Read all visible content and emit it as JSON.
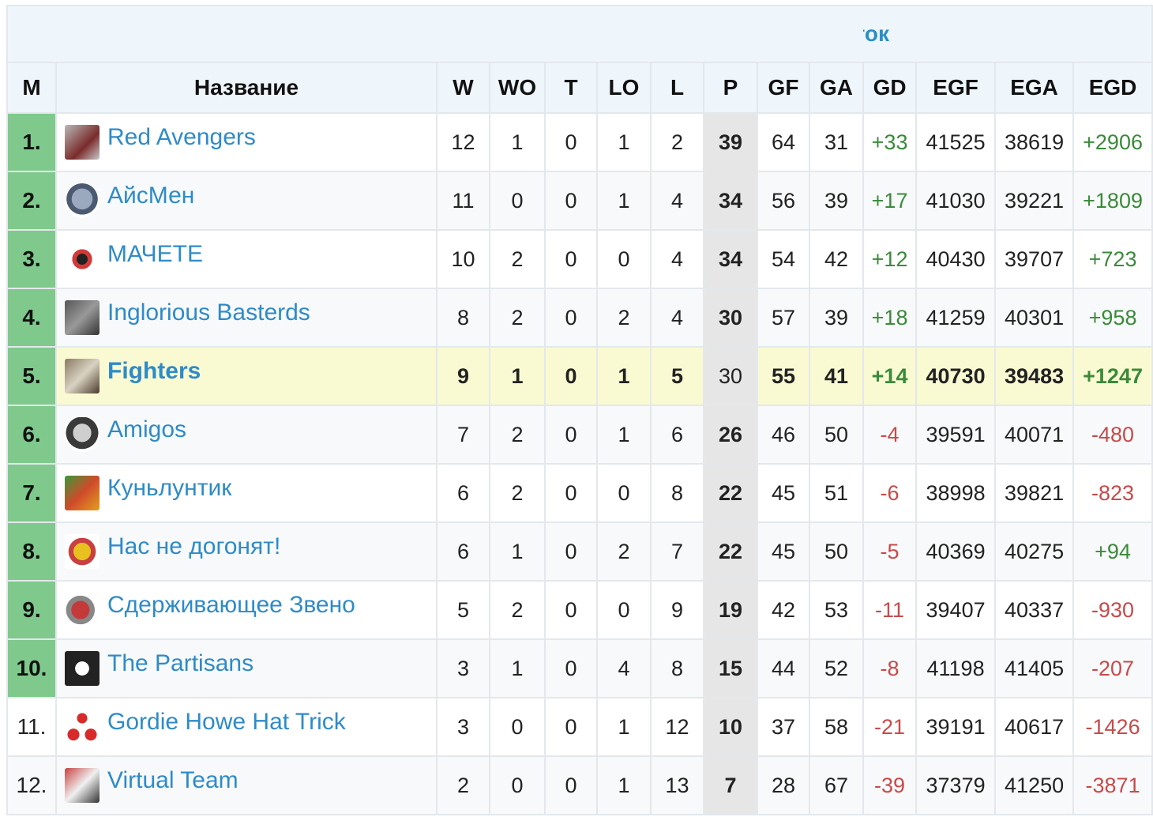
{
  "conference": "Восток",
  "columns": [
    "М",
    "Название",
    "W",
    "WO",
    "T",
    "LO",
    "L",
    "P",
    "GF",
    "GA",
    "GD",
    "EGF",
    "EGA",
    "EGD"
  ],
  "colors": {
    "link": "#2e8bc8",
    "playoff": "#7fc98c",
    "highlight": "#fafad2",
    "positive": "#3a8a3a",
    "negative": "#c84a4a"
  },
  "rows": [
    {
      "pos": "1.",
      "team": "Red Avengers",
      "icon": "red-avengers-logo",
      "W": "12",
      "WO": "1",
      "T": "0",
      "LO": "1",
      "L": "2",
      "P": "39",
      "GF": "64",
      "GA": "31",
      "GD": "+33",
      "EGF": "41525",
      "EGA": "38619",
      "EGD": "+2906"
    },
    {
      "pos": "2.",
      "team": "АйсМен",
      "icon": "icemen-logo",
      "W": "11",
      "WO": "0",
      "T": "0",
      "LO": "1",
      "L": "4",
      "P": "34",
      "GF": "56",
      "GA": "39",
      "GD": "+17",
      "EGF": "41030",
      "EGA": "39221",
      "EGD": "+1809"
    },
    {
      "pos": "3.",
      "team": "МАЧЕТЕ",
      "icon": "machete-logo",
      "W": "10",
      "WO": "2",
      "T": "0",
      "LO": "0",
      "L": "4",
      "P": "34",
      "GF": "54",
      "GA": "42",
      "GD": "+12",
      "EGF": "40430",
      "EGA": "39707",
      "EGD": "+723"
    },
    {
      "pos": "4.",
      "team": "Inglorious Basterds",
      "icon": "inglorious-basterds-logo",
      "W": "8",
      "WO": "2",
      "T": "0",
      "LO": "2",
      "L": "4",
      "P": "30",
      "GF": "57",
      "GA": "39",
      "GD": "+18",
      "EGF": "41259",
      "EGA": "40301",
      "EGD": "+958"
    },
    {
      "pos": "5.",
      "team": "Fighters",
      "icon": "fighters-logo",
      "W": "9",
      "WO": "1",
      "T": "0",
      "LO": "1",
      "L": "5",
      "P": "30",
      "GF": "55",
      "GA": "41",
      "GD": "+14",
      "EGF": "40730",
      "EGA": "39483",
      "EGD": "+1247"
    },
    {
      "pos": "6.",
      "team": "Amigos",
      "icon": "nhl-shield-logo",
      "W": "7",
      "WO": "2",
      "T": "0",
      "LO": "1",
      "L": "6",
      "P": "26",
      "GF": "46",
      "GA": "50",
      "GD": "-4",
      "EGF": "39591",
      "EGA": "40071",
      "EGD": "-480"
    },
    {
      "pos": "7.",
      "team": "Куньлунтик",
      "icon": "kunluntik-logo",
      "W": "6",
      "WO": "2",
      "T": "0",
      "LO": "0",
      "L": "8",
      "P": "22",
      "GF": "45",
      "GA": "51",
      "GD": "-6",
      "EGF": "38998",
      "EGA": "39821",
      "EGD": "-823"
    },
    {
      "pos": "8.",
      "team": "Нас не догонят!",
      "icon": "nas-ne-dogonyat-logo",
      "W": "6",
      "WO": "1",
      "T": "0",
      "LO": "2",
      "L": "7",
      "P": "22",
      "GF": "45",
      "GA": "50",
      "GD": "-5",
      "EGF": "40369",
      "EGA": "40275",
      "EGD": "+94"
    },
    {
      "pos": "9.",
      "team": "Сдерживающее Звено",
      "icon": "sderzhivayushchee-zveno-logo",
      "W": "5",
      "WO": "2",
      "T": "0",
      "LO": "0",
      "L": "9",
      "P": "19",
      "GF": "42",
      "GA": "53",
      "GD": "-11",
      "EGF": "39407",
      "EGA": "40337",
      "EGD": "-930"
    },
    {
      "pos": "10.",
      "team": "The Partisans",
      "icon": "partisans-logo",
      "W": "3",
      "WO": "1",
      "T": "0",
      "LO": "4",
      "L": "8",
      "P": "15",
      "GF": "44",
      "GA": "52",
      "GD": "-8",
      "EGF": "41198",
      "EGA": "41405",
      "EGD": "-207"
    },
    {
      "pos": "11.",
      "team": "Gordie Howe Hat Trick",
      "icon": "gordie-howe-logo",
      "W": "3",
      "WO": "0",
      "T": "0",
      "LO": "1",
      "L": "12",
      "P": "10",
      "GF": "37",
      "GA": "58",
      "GD": "-21",
      "EGF": "39191",
      "EGA": "40617",
      "EGD": "-1426"
    },
    {
      "pos": "12.",
      "team": "Virtual Team",
      "icon": "virtual-team-logo",
      "W": "2",
      "WO": "0",
      "T": "0",
      "LO": "1",
      "L": "13",
      "P": "7",
      "GF": "28",
      "GA": "67",
      "GD": "-39",
      "EGF": "37379",
      "EGA": "41250",
      "EGD": "-3871"
    }
  ]
}
